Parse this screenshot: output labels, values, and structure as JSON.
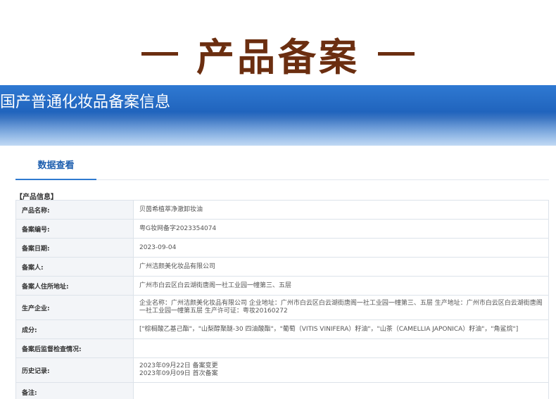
{
  "heading": {
    "dash_left": "—",
    "title": "产品备案",
    "dash_right": "—"
  },
  "banner": {
    "title": "国产普通化妆品备案信息"
  },
  "tabs": [
    {
      "label": "数据查看",
      "active": true
    }
  ],
  "section": {
    "label": "【产品信息】"
  },
  "rows": [
    {
      "key": "产品名称:",
      "value": "贝茵希植萃净澈卸妆油"
    },
    {
      "key": "备案编号:",
      "value": "粤G妆网备字2023354074"
    },
    {
      "key": "备案日期:",
      "value": "2023-09-04"
    },
    {
      "key": "备案人:",
      "value": "广州洁颜美化妆品有限公司"
    },
    {
      "key": "备案人住所地址:",
      "value": "广州市白云区白云湖街唐阁一社工业园一幢第三、五层"
    },
    {
      "key": "生产企业:",
      "value": "企业名称：广州洁颜美化妆品有限公司 企业地址：广州市白云区白云湖街唐阁一社工业园一幢第三、五层 生产地址：广州市白云区白云湖街唐阁一社工业园一幢第五层 生产许可证：粤妆20160272"
    },
    {
      "key": "成分:",
      "value": "[\"棕榈酸乙基己酯\"，\"山梨醇聚醚-30 四油酸酯\"，\"葡萄（VITIS VINIFERA）籽油\"，\"山茶（CAMELLIA JAPONICA）籽油\"，\"角鲨烷\"]"
    },
    {
      "key": "备案后监督检查情况:",
      "value": ""
    },
    {
      "key": "历史记录:",
      "value": "2023年09月22日 备案变更",
      "value2": "2023年09月09日 首次备案"
    },
    {
      "key": "备注:",
      "value": ""
    }
  ],
  "colors": {
    "heading": "#6b2e10",
    "banner": "#1d5fb8",
    "tab_active": "#1e5faf"
  }
}
